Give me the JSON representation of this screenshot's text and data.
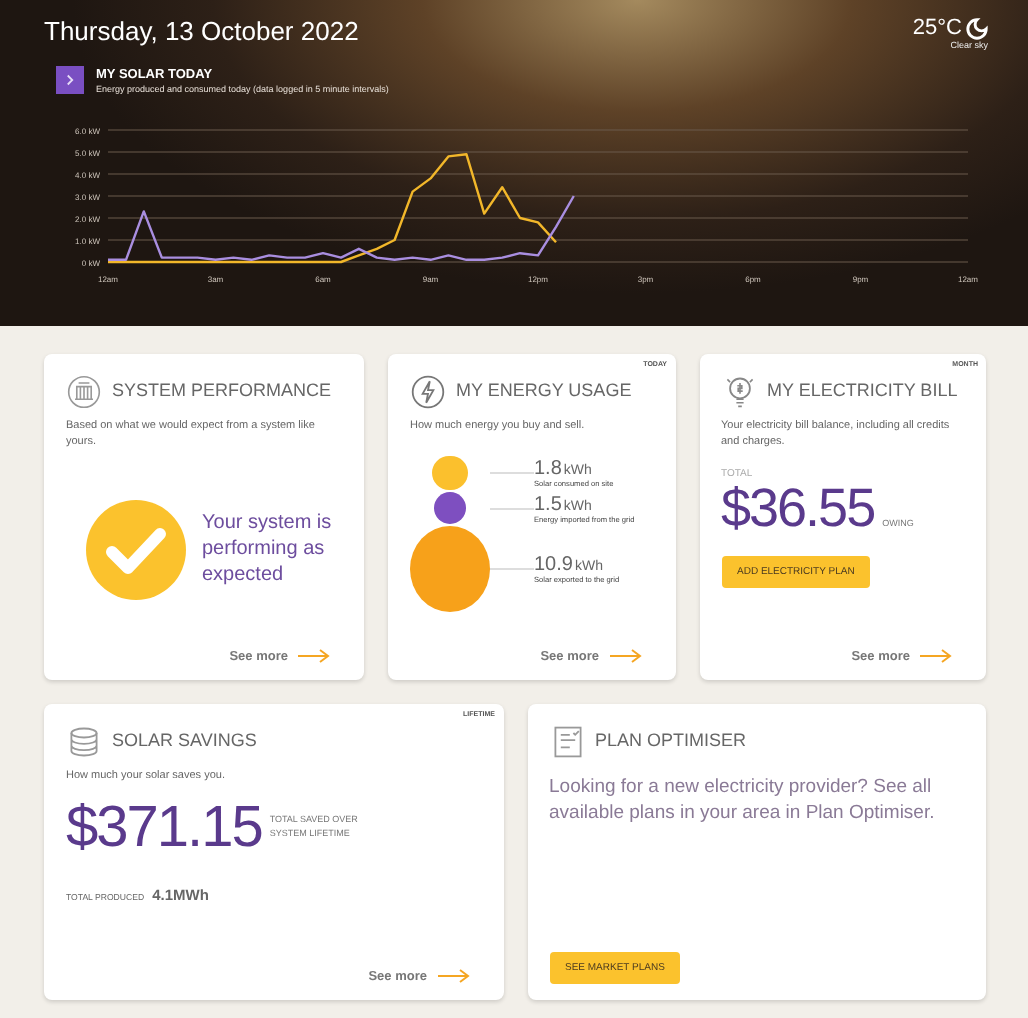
{
  "header": {
    "date": "Thursday, 13 October 2022",
    "weather": {
      "temperature": "25°C",
      "condition": "Clear sky"
    }
  },
  "solar_today": {
    "title": "MY SOLAR TODAY",
    "subtitle": "Energy produced and consumed today (data logged in 5 minute intervals)",
    "chart_data": {
      "type": "line",
      "categories": [
        "12am",
        null,
        null,
        null,
        null,
        null,
        "3am",
        null,
        null,
        null,
        null,
        null,
        "6am",
        null,
        null,
        null,
        null,
        null,
        "9am",
        null,
        null,
        null,
        null,
        null,
        "12pm",
        null,
        null,
        null,
        null,
        null,
        "3pm",
        null,
        null,
        null,
        null,
        null,
        "6pm",
        null,
        null,
        null,
        null,
        null,
        "9pm",
        null,
        null,
        null,
        null,
        null,
        "12am"
      ],
      "series": [
        {
          "color": "#f2b72a",
          "values": [
            0,
            0,
            0,
            0,
            0,
            0,
            0,
            0,
            0,
            0,
            0,
            0,
            0,
            0,
            0.3,
            0.6,
            1.0,
            3.2,
            3.8,
            4.8,
            4.9,
            2.2,
            3.4,
            2.0,
            1.8,
            0.9,
            null,
            null,
            null,
            null,
            null,
            null,
            null,
            null,
            null,
            null,
            null,
            null,
            null,
            null,
            null,
            null,
            null,
            null,
            null,
            null,
            null,
            null,
            null
          ]
        },
        {
          "color": "#a98ee0",
          "values": [
            0.1,
            0.1,
            2.3,
            0.2,
            0.2,
            0.2,
            0.1,
            0.2,
            0.1,
            0.3,
            0.2,
            0.2,
            0.4,
            0.2,
            0.6,
            0.2,
            0.1,
            0.2,
            0.1,
            0.3,
            0.1,
            0.1,
            0.2,
            0.4,
            0.3,
            1.6,
            3.0,
            null,
            null,
            null,
            null,
            null,
            null,
            null,
            null,
            null,
            null,
            null,
            null,
            null,
            null,
            null,
            null,
            null,
            null,
            null,
            null,
            null,
            null
          ]
        }
      ],
      "ylim": [
        0,
        6
      ],
      "grid": true,
      "yticks": [
        {
          "value": 0,
          "label": "0 kW"
        },
        {
          "value": 1,
          "label": "1.0 kW"
        },
        {
          "value": 2,
          "label": "2.0 kW"
        },
        {
          "value": 3,
          "label": "3.0 kW"
        },
        {
          "value": 4,
          "label": "4.0 kW"
        },
        {
          "value": 5,
          "label": "5.0 kW"
        },
        {
          "value": 6,
          "label": "6.0 kW"
        }
      ]
    }
  },
  "rows": [
    [
      {
        "kind": "performance",
        "title": "SYSTEM PERFORMANCE",
        "description": "Based on what we would expect from a system like yours.",
        "status": "Your system is performing as expected",
        "link": "See more"
      },
      {
        "kind": "usage",
        "title": "MY ENERGY USAGE",
        "tag": "TODAY",
        "description": "How much energy you buy and sell.",
        "items": [
          {
            "value": "1.8",
            "unit": "kWh",
            "label": "Solar consumed on site",
            "color": "#fbc02d"
          },
          {
            "value": "1.5",
            "unit": "kWh",
            "label": "Energy imported from the grid",
            "color": "#7e4fc0"
          },
          {
            "value": "10.9",
            "unit": "kWh",
            "label": "Solar exported to the grid",
            "color": "#f7a11a"
          }
        ],
        "link": "See more"
      },
      {
        "kind": "bill",
        "title": "MY ELECTRICITY BILL",
        "tag": "MONTH",
        "description": "Your electricity bill balance, including all credits and charges.",
        "total_label": "TOTAL",
        "amount": "$36.55",
        "amount_note": "OWING",
        "button": "ADD ELECTRICITY PLAN",
        "link": "See more"
      }
    ],
    [
      {
        "kind": "savings",
        "title": "SOLAR SAVINGS",
        "tag": "LIFETIME",
        "description": "How much your solar saves you.",
        "amount": "$371.15",
        "amount_note": "TOTAL SAVED OVER SYSTEM LIFETIME",
        "produced_label": "TOTAL PRODUCED",
        "produced_value": "4.1MWh",
        "link": "See more"
      },
      {
        "kind": "optimiser",
        "title": "PLAN OPTIMISER",
        "description": "Looking for a new electricity provider? See all available plans in your area in Plan Optimiser.",
        "button": "SEE MARKET PLANS"
      }
    ]
  ]
}
